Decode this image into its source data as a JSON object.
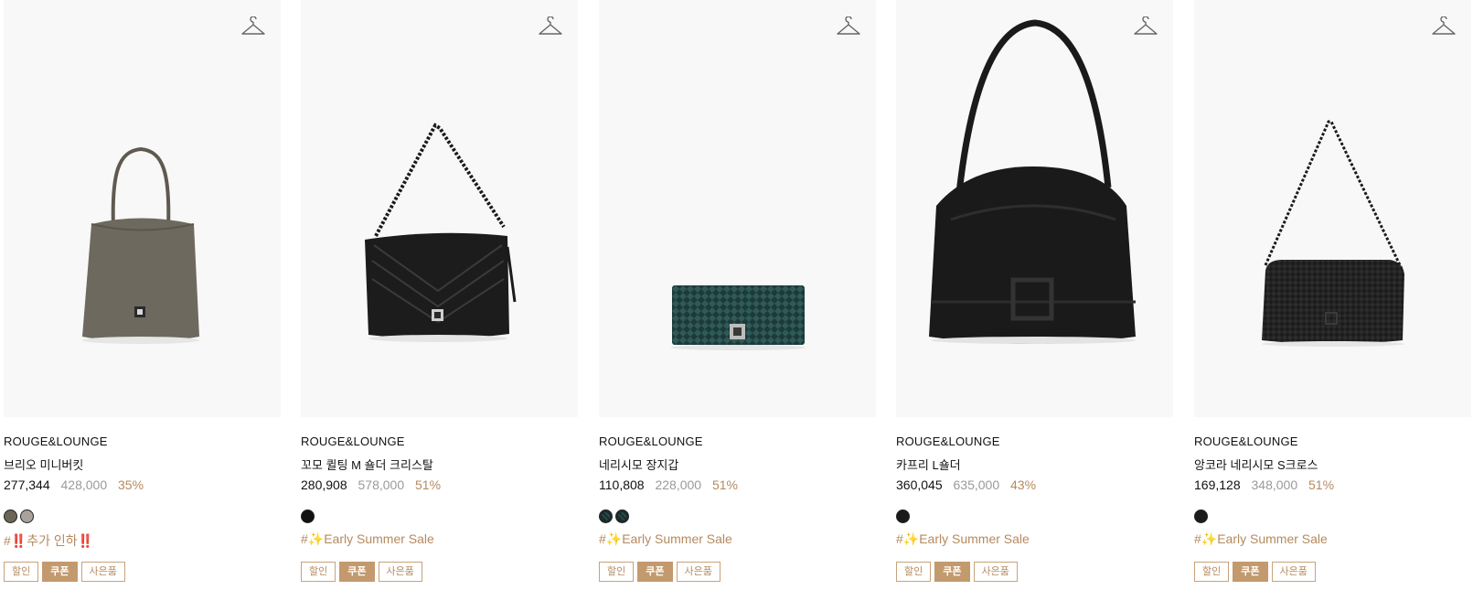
{
  "products": [
    {
      "brand": "ROUGE&LOUNGE",
      "name": "브리오 미니버킷",
      "price": "277,344",
      "original_price": "428,000",
      "discount": "35%",
      "swatches": [
        "#6b6558",
        "#a9a29a"
      ],
      "tag": "#‼️추가 인하‼️",
      "badges": [
        "할인",
        "쿠폰",
        "사은품"
      ],
      "wishlist_icon": "hanger-icon",
      "image_icon": "taupe-bucket-bag"
    },
    {
      "brand": "ROUGE&LOUNGE",
      "name": "꼬모 퀼팅 M 숄더 크리스탈",
      "price": "280,908",
      "original_price": "578,000",
      "discount": "51%",
      "swatches": [
        "#111111"
      ],
      "tag": "#✨Early Summer Sale",
      "badges": [
        "할인",
        "쿠폰",
        "사은품"
      ],
      "wishlist_icon": "hanger-icon",
      "image_icon": "black-quilted-shoulder-bag"
    },
    {
      "brand": "ROUGE&LOUNGE",
      "name": "네리시모 장지갑",
      "price": "110,808",
      "original_price": "228,000",
      "discount": "51%",
      "swatches": [
        "#1c2b2b",
        "#1c2b2b"
      ],
      "tag": "#✨Early Summer Sale",
      "badges": [
        "할인",
        "쿠폰",
        "사은품"
      ],
      "wishlist_icon": "hanger-icon",
      "image_icon": "green-long-wallet"
    },
    {
      "brand": "ROUGE&LOUNGE",
      "name": "카프리 L숄더",
      "price": "360,045",
      "original_price": "635,000",
      "discount": "43%",
      "swatches": [
        "#1a1a1a"
      ],
      "tag": "#✨Early Summer Sale",
      "badges": [
        "할인",
        "쿠폰",
        "사은품"
      ],
      "wishlist_icon": "hanger-icon",
      "image_icon": "black-large-shoulder-bag"
    },
    {
      "brand": "ROUGE&LOUNGE",
      "name": "앙코라 네리시모 S크로스",
      "price": "169,128",
      "original_price": "348,000",
      "discount": "51%",
      "swatches": [
        "#1c1c1c"
      ],
      "tag": "#✨Early Summer Sale",
      "badges": [
        "할인",
        "쿠폰",
        "사은품"
      ],
      "wishlist_icon": "hanger-icon",
      "image_icon": "black-woven-crossbody-bag"
    }
  ],
  "colors": {
    "accent": "#b58a5f",
    "badge_fill": "#c39a6e",
    "muted": "#9a9a9a",
    "thumb_bg": "#f8f8f8"
  }
}
